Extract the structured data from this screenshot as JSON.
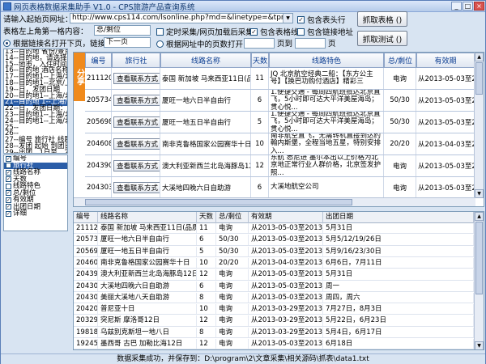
{
  "window": {
    "title": "网页表格数据采集助手 V1.0 - CPS旅游产品查询系统"
  },
  "form": {
    "url_label": "请输入起始页网址：",
    "url_value": "http://www.cps114.com/lsonline.php?md=&linetype=&tprice=&keyword=&contents",
    "header_label": "表格左上角第一格内容：",
    "header_value": "总/剩位",
    "include_header": "包含表头行",
    "timed_append": "定时采集/网页加载后采集",
    "include_borders": "包含表格线",
    "include_links": "包含链接地址",
    "mode_a_label": "根据链接名打开下页，链接名称：",
    "mode_a_value": "下一页",
    "mode_b_label": "根据网址中的页数打开，从",
    "mode_b_mid": "页到",
    "mode_b_end": "页",
    "capture_button": "抓取表格 ()",
    "test_button": "抓取测试 ()"
  },
  "left_log": [
    "13--目的地 省份/景点.",
    "14--目的地，请选择省",
    "15--地市，入住时间 集",
    "16--目的地 酒店名称",
    "17--目的地1--上海/北京",
    "18--目的地1--北京/上海",
    "19--日，发团日期",
    "20--目的地1--上海/北",
    "21--目的地 1--上海/北",
    "22--日，发团日期：",
    "23--目的地1--上海/北京",
    "24--目的地1--上海/北",
    "25--",
    "26--",
    "27--编号 旅行社 线路",
    "28--发团 起始 到团日",
    "29--出团，1日至，2日至",
    "30--这已选择的网络图"
  ],
  "fields": [
    {
      "label": "编号",
      "checked": true
    },
    {
      "label": "旅行社",
      "checked": false,
      "selected": true
    },
    {
      "label": "线路名称",
      "checked": true
    },
    {
      "label": "天数",
      "checked": true
    },
    {
      "label": "线路特色",
      "checked": false
    },
    {
      "label": "总/剩位",
      "checked": true
    },
    {
      "label": "有效期",
      "checked": true
    },
    {
      "label": "出团日期",
      "checked": true
    },
    {
      "label": "详细",
      "checked": true
    }
  ],
  "preview": {
    "side_tab": "分享",
    "headers": [
      "编号",
      "旅行社",
      "线路名称",
      "天数",
      "线路特色",
      "总/剩位",
      "有效期"
    ],
    "contact_label": "查看联系方式",
    "rows": [
      {
        "id": "211120",
        "route": "泰国 新加坡 马来西亚11日(品质团)",
        "days": "11",
        "feature": "JQ 北京航空经典二船：【东方公主号】【换巴功购付酒店】精彩三",
        "seats": "电询",
        "valid": "从2013-05-03至2013-05-3"
      },
      {
        "id": "205734",
        "route": "厦旺一地六日半自由行",
        "days": "6",
        "feature": "1.便捷交通 - 每周四航班抵达北京直飞，5小时即可达大平洋美屋海岛；贯心悦...",
        "seats": "50/30",
        "valid": "从2013-05-03至2013-05-3"
      },
      {
        "id": "205698",
        "route": "厦旺一地五日半自由行",
        "days": "5",
        "feature": "1.便捷交通 - 每周四航班抵达北京直飞，5小时即可达大平洋美屋海岛；贯心悦...",
        "seats": "50/30",
        "valid": "从2013-05-03至2013-05-3"
      },
      {
        "id": "204608",
        "route": "南非克鲁格国家公园赛华十日",
        "days": "10",
        "feature": "南非航空直飞，无需转机直接到达约翰内斯堡，全程当地五星，特别安排入...",
        "seats": "20/20",
        "valid": "从2013-04-03至2013-04-2"
      },
      {
        "id": "204390",
        "route": "澳大利亚新西兰北岛海豚岛12日(4星)",
        "days": "12",
        "feature": "东航 悉尼进 墨尔本出以上价格为北京地正常行业人群价格，北京签发护照...",
        "seats": "电询",
        "valid": "从2013-05-03至2013-05-3"
      },
      {
        "id": "204303",
        "route": "大溪地四晚六日自助游",
        "days": "6",
        "feature": "大溪地航空公司",
        "seats": "电询",
        "valid": "从2013-05-03至2013-05-3"
      }
    ]
  },
  "results": {
    "headers": [
      "编号",
      "线路名称",
      "天数",
      "总/剩位",
      "有效期",
      "出团日期"
    ],
    "rows": [
      [
        "211120",
        "泰国 新加坡 马来西亚11日(品质团)",
        "11",
        "电询",
        "从2013-05-03至2013-05-31",
        "5月31日"
      ],
      [
        "205734",
        "厦旺一地六日半自由行",
        "6",
        "50/30",
        "从2013-05-03至2013-05-31",
        "5月5/12/19/26日"
      ],
      [
        "205698",
        "厦旺一地五日半自由行",
        "5",
        "50/30",
        "从2013-05-03至2013-05-31",
        "5月9/16/23/30日"
      ],
      [
        "204608",
        "南非克鲁格国家公园赛华十日",
        "10",
        "20/20",
        "从2013-04-03至2013-04-27",
        "6月6日，7月11日"
      ],
      [
        "204390",
        "澳大利亚新西兰北岛海豚岛12日(4星)",
        "12",
        "电询",
        "从2013-05-03至2013-05-31",
        "5月31日"
      ],
      [
        "204303",
        "大溪地四晚六日自助游",
        "6",
        "电询",
        "从2013-05-03至2013-05-31",
        "周一"
      ],
      [
        "204300",
        "美丽大溪地八天自助游",
        "8",
        "电询",
        "从2013-05-03至2013-05-31",
        "周四，周六"
      ],
      [
        "204209",
        "普尼亚十日",
        "10",
        "电询",
        "从2013-03-29至2013-08-30",
        "7月27日，8月3日"
      ],
      [
        "203298",
        "突尼斯 摩洛哥12日",
        "12",
        "电询",
        "从2013-03-29至2013-05-31",
        "5月22日，6月23日"
      ],
      [
        "198180",
        "乌兹别克斯坦一地八日",
        "8",
        "电询",
        "从2013-03-29至2013-05-31",
        "5月4日，6月17日"
      ],
      [
        "192450",
        "墨西哥 古巴 加勒比海12日",
        "12",
        "电询",
        "从2013-05-03至2013-05-31",
        "6月18日"
      ]
    ]
  },
  "status": "数据采集成功，并保存到：D:\\program\\2\\文章采集\\相关源码\\抓表\\data1.txt"
}
